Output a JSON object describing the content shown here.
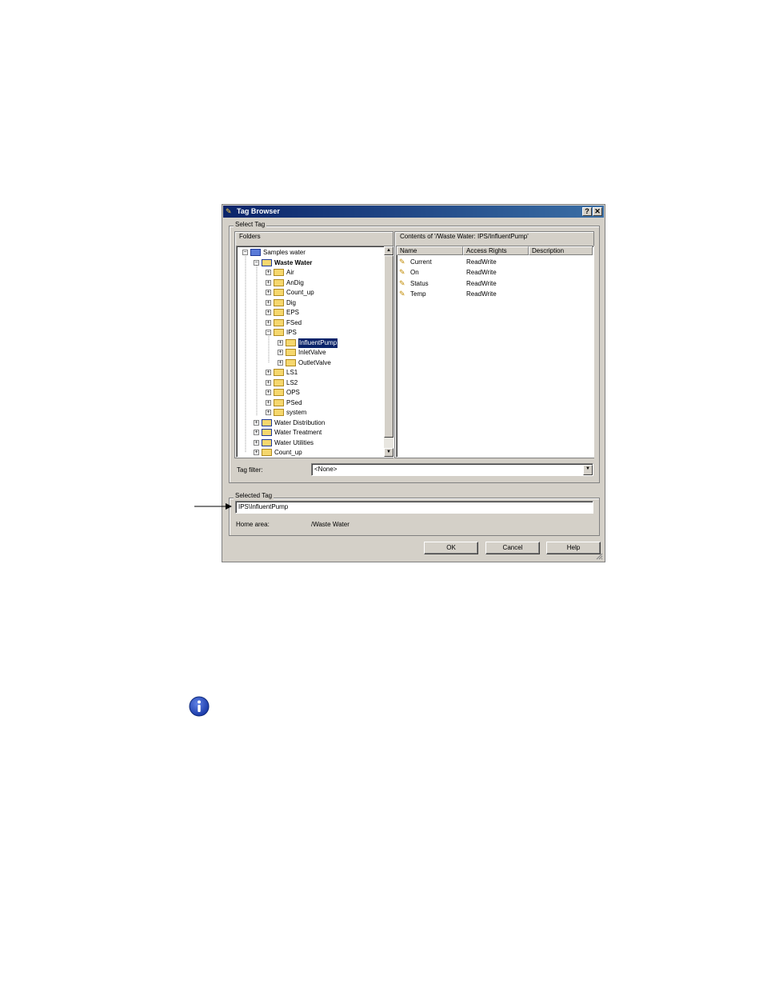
{
  "dialog": {
    "title": "Tag Browser",
    "help_button": "?",
    "close_button": "✕"
  },
  "select_tag": {
    "legend": "Select Tag",
    "folders_label": "Folders",
    "contents_label": "Contents of '/Waste Water: IPS/InfluentPump'",
    "tree": [
      {
        "label": "Samples water",
        "level": 0,
        "expander": "−",
        "icon": "project-icon",
        "bold": false
      },
      {
        "label": "Waste Water",
        "level": 1,
        "expander": "−",
        "icon": "area-icon",
        "bold": true
      },
      {
        "label": "Air",
        "level": 2,
        "expander": "+",
        "icon": "folder-icon"
      },
      {
        "label": "AnDig",
        "level": 2,
        "expander": "+",
        "icon": "folder-icon"
      },
      {
        "label": "Count_up",
        "level": 2,
        "expander": "+",
        "icon": "folder-icon"
      },
      {
        "label": "Dig",
        "level": 2,
        "expander": "+",
        "icon": "folder-icon"
      },
      {
        "label": "EPS",
        "level": 2,
        "expander": "+",
        "icon": "folder-icon"
      },
      {
        "label": "FSed",
        "level": 2,
        "expander": "+",
        "icon": "folder-icon"
      },
      {
        "label": "IPS",
        "level": 2,
        "expander": "−",
        "icon": "folder-icon"
      },
      {
        "label": "InfluentPump",
        "level": 3,
        "expander": "+",
        "icon": "folder-icon",
        "selected": true
      },
      {
        "label": "InletValve",
        "level": 3,
        "expander": "+",
        "icon": "folder-icon"
      },
      {
        "label": "OutletValve",
        "level": 3,
        "expander": "+",
        "icon": "folder-icon"
      },
      {
        "label": "LS1",
        "level": 2,
        "expander": "+",
        "icon": "folder-icon"
      },
      {
        "label": "LS2",
        "level": 2,
        "expander": "+",
        "icon": "folder-icon"
      },
      {
        "label": "OPS",
        "level": 2,
        "expander": "+",
        "icon": "folder-icon"
      },
      {
        "label": "PSed",
        "level": 2,
        "expander": "+",
        "icon": "folder-icon"
      },
      {
        "label": "system",
        "level": 2,
        "expander": "+",
        "icon": "folder-icon"
      },
      {
        "label": "Water Distribution",
        "level": 1,
        "expander": "+",
        "icon": "area-icon"
      },
      {
        "label": "Water Treatment",
        "level": 1,
        "expander": "+",
        "icon": "area-icon"
      },
      {
        "label": "Water Utilities",
        "level": 1,
        "expander": "+",
        "icon": "area-icon"
      },
      {
        "label": "Count_up",
        "level": 1,
        "expander": "+",
        "icon": "folder-icon"
      }
    ],
    "columns": [
      "Name",
      "Access Rights",
      "Description"
    ],
    "rows": [
      {
        "name": "Current",
        "access": "ReadWrite",
        "description": ""
      },
      {
        "name": "On",
        "access": "ReadWrite",
        "description": ""
      },
      {
        "name": "Status",
        "access": "ReadWrite",
        "description": ""
      },
      {
        "name": "Temp",
        "access": "ReadWrite",
        "description": ""
      }
    ],
    "tag_filter_label": "Tag filter:",
    "tag_filter_value": "<None>"
  },
  "selected_tag": {
    "legend": "Selected Tag",
    "value": "IPS\\InfluentPump",
    "home_area_label": "Home area:",
    "home_area_value": "/Waste Water"
  },
  "buttons": {
    "ok": "OK",
    "cancel": "Cancel",
    "help": "Help"
  },
  "colors": {
    "title_bar": "#0a246a",
    "dialog_bg": "#d4d0c8",
    "info_icon": "#1a3aa8"
  },
  "icons": {
    "callout": "arrow-icon",
    "note": "info-icon"
  }
}
